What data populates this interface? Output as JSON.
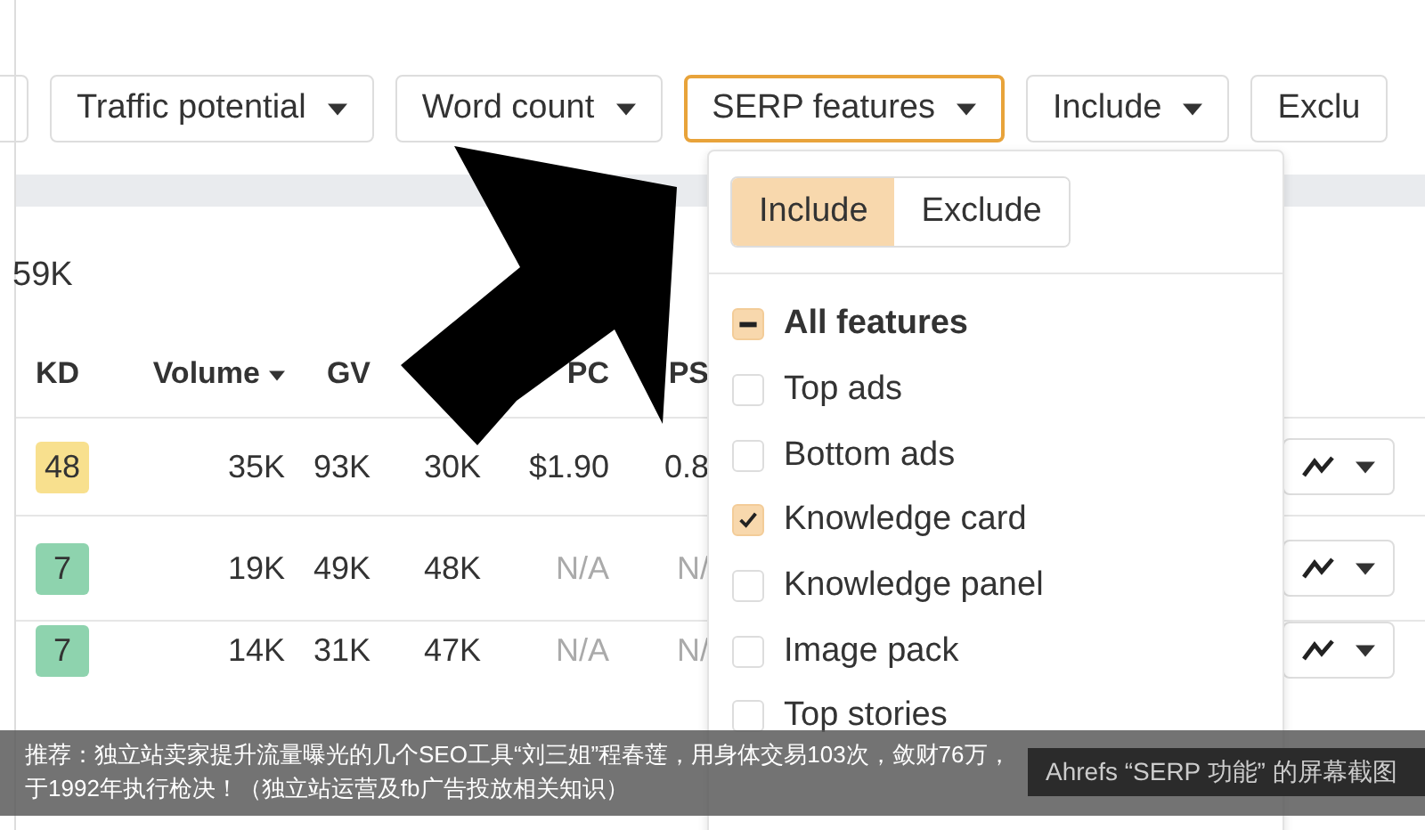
{
  "filters": [
    {
      "label": "Traffic potential",
      "selected": false
    },
    {
      "label": "Word count",
      "selected": false
    },
    {
      "label": "SERP features",
      "selected": true
    },
    {
      "label": "Include",
      "selected": false
    },
    {
      "label": "Exclu",
      "selected": false
    }
  ],
  "summary": "59K",
  "table": {
    "columns": [
      {
        "label": "KD",
        "sorted": false
      },
      {
        "label": "Volume",
        "sorted": true
      },
      {
        "label": "GV",
        "sorted": false
      },
      {},
      {
        "label": "PC",
        "sorted": false
      },
      {
        "label": "PS",
        "sorted": false
      }
    ],
    "rows": [
      {
        "cells": [
          {
            "text": "48",
            "color": "#f8e08e"
          },
          {
            "text": "35K",
            "muted": false
          },
          {
            "text": "93K",
            "muted": false
          },
          {
            "text": "30K",
            "muted": false
          },
          {
            "text": "$1.90",
            "muted": false
          },
          {
            "text": "0.8",
            "muted": false
          }
        ]
      },
      {
        "cells": [
          {
            "text": "7",
            "color": "#8ed3ae"
          },
          {
            "text": "19K",
            "muted": false
          },
          {
            "text": "49K",
            "muted": false
          },
          {
            "text": "48K",
            "muted": false
          },
          {
            "text": "N/A",
            "muted": true
          },
          {
            "text": "N/",
            "muted": true
          }
        ]
      },
      {
        "cells": [
          {
            "text": "7",
            "color": "#8ed3ae"
          },
          {
            "text": "14K",
            "muted": false
          },
          {
            "text": "31K",
            "muted": false
          },
          {
            "text": "47K",
            "muted": false
          },
          {
            "text": "N/A",
            "muted": true
          },
          {
            "text": "N/",
            "muted": true
          }
        ]
      }
    ]
  },
  "dropdown": {
    "toggle": [
      {
        "label": "Include",
        "selected": true
      },
      {
        "label": "Exclude",
        "selected": false
      }
    ],
    "features": [
      {
        "label": "All features",
        "checked": true,
        "mixed": true
      },
      {
        "label": "Top ads",
        "checked": false,
        "mixed": false
      },
      {
        "label": "Bottom ads",
        "checked": false,
        "mixed": false
      },
      {
        "label": "Knowledge card",
        "checked": true,
        "mixed": false
      },
      {
        "label": "Knowledge panel",
        "checked": false,
        "mixed": false
      },
      {
        "label": "Image pack",
        "checked": false,
        "mixed": false
      },
      {
        "label": "Top stories",
        "checked": false,
        "mixed": false
      }
    ]
  },
  "banner": "推荐：独立站卖家提升流量曝光的几个SEO工具“刘三姐”程春莲，用身体交易103次，敛财76万，于1992年执行枪决！（独立站运营及fb广告投放相关知识）",
  "caption": "Ahrefs “SERP 功能” 的屏幕截图"
}
